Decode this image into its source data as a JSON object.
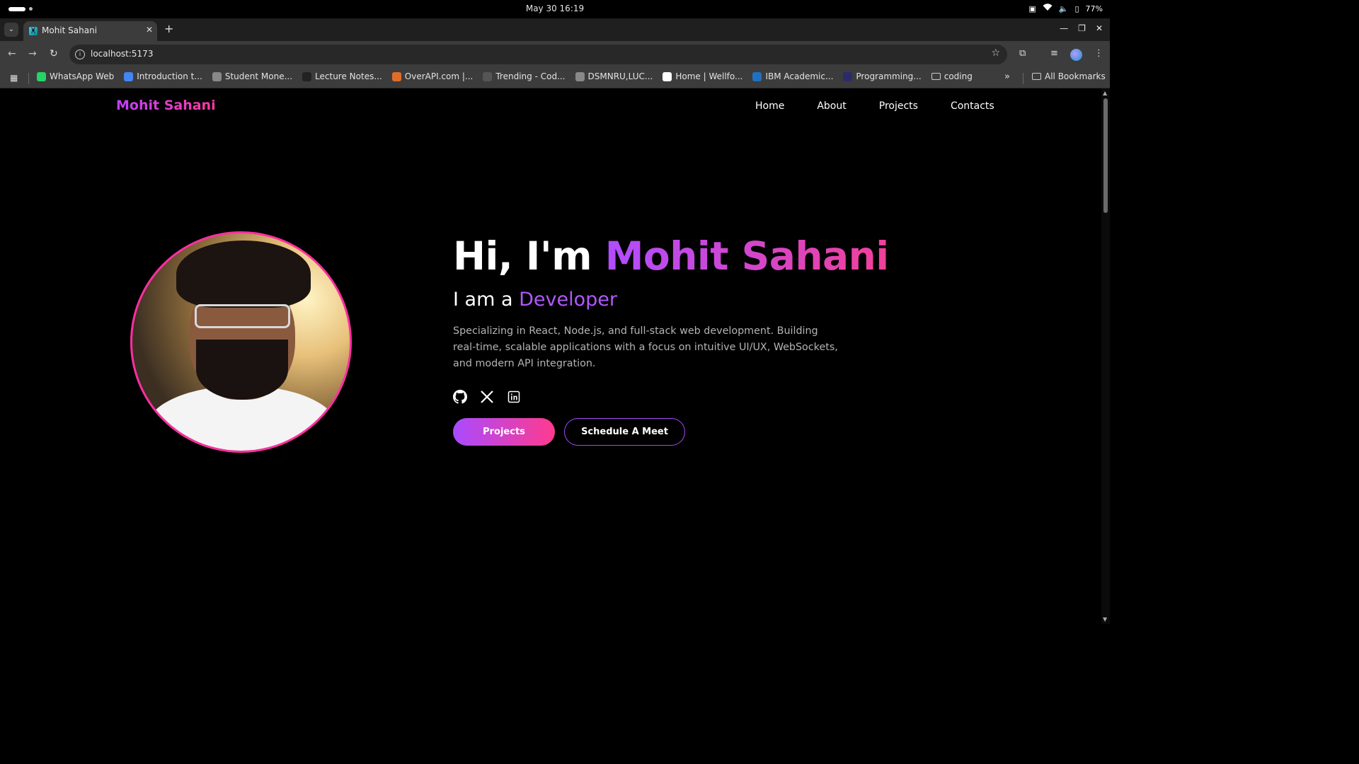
{
  "os": {
    "clock": "May 30  16:19",
    "battery": "77%"
  },
  "browser": {
    "tab_title": "Mohit Sahani",
    "url": "localhost:5173",
    "bookmarks": [
      {
        "label": "WhatsApp Web",
        "icon": "whatsapp-icon",
        "color": "#25d366"
      },
      {
        "label": "Introduction t...",
        "icon": "google-icon",
        "color": "#4285f4"
      },
      {
        "label": "Student Mone...",
        "icon": "globe-icon",
        "color": "#888888"
      },
      {
        "label": "Lecture Notes...",
        "icon": "notes-icon",
        "color": "#222222"
      },
      {
        "label": "OverAPI.com |...",
        "icon": "overapi-icon",
        "color": "#e06c2a"
      },
      {
        "label": "Trending - Cod...",
        "icon": "codepen-icon",
        "color": "#555555"
      },
      {
        "label": "DSMNRU,LUC...",
        "icon": "globe-icon",
        "color": "#888888"
      },
      {
        "label": "Home | Wellfo...",
        "icon": "wellfound-icon",
        "color": "#ffffff"
      },
      {
        "label": "IBM Academic...",
        "icon": "ibm-icon",
        "color": "#1f70c1"
      },
      {
        "label": "Programming...",
        "icon": "programming-icon",
        "color": "#2b2b6b"
      },
      {
        "label": "coding",
        "icon": "folder-icon",
        "color": "#cccccc"
      }
    ],
    "all_bookmarks": "All Bookmarks"
  },
  "site": {
    "logo": "Mohit Sahani",
    "nav": [
      "Home",
      "About",
      "Projects",
      "Contacts"
    ],
    "accent_start": "#b04dff",
    "accent_end": "#f2409a",
    "hero": {
      "greeting": "Hi, I'm ",
      "name": "Mohit Sahani",
      "sub_prefix": "I am a ",
      "role": "Developer",
      "description": "Specializing in React, Node.js, and full-stack web development. Building real-time, scalable applications with a focus on intuitive UI/UX, WebSockets, and modern API integration.",
      "socials": [
        "github-icon",
        "x-icon",
        "linkedin-icon"
      ],
      "primary_button": "Projects",
      "secondary_button": "Schedule A Meet"
    }
  }
}
